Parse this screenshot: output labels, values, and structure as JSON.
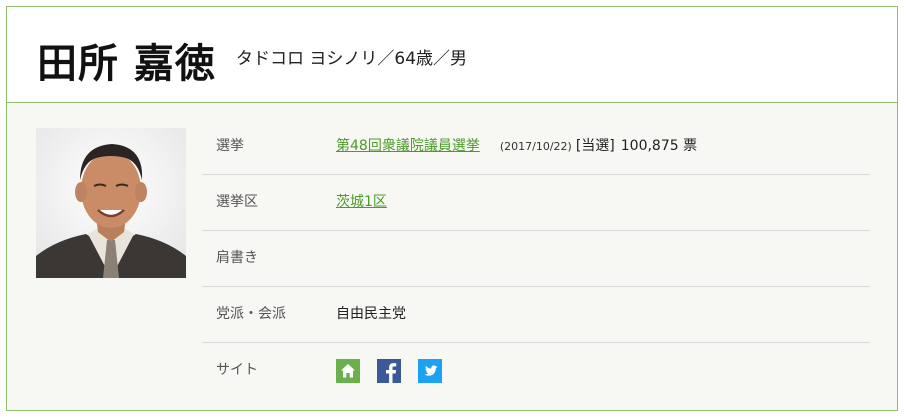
{
  "profile": {
    "name": "田所 嘉徳",
    "sub_info": "タドコロ ヨシノリ／64歳／男"
  },
  "details": {
    "election": {
      "label": "選挙",
      "link": "第48回衆議院議員選挙",
      "date": "(2017/10/22)",
      "result": "[当選]",
      "votes": "100,875 票"
    },
    "district": {
      "label": "選挙区",
      "link": "茨城1区"
    },
    "title": {
      "label": "肩書き",
      "value": ""
    },
    "party": {
      "label": "党派・会派",
      "value": "自由民主党"
    },
    "site": {
      "label": "サイト",
      "icons": [
        "home-icon",
        "facebook-icon",
        "twitter-icon"
      ]
    }
  },
  "colors": {
    "accent": "#4c9a2a",
    "border": "#8fbf6a",
    "home": "#6ab04c",
    "facebook": "#3b5998",
    "twitter": "#1da1f2"
  }
}
